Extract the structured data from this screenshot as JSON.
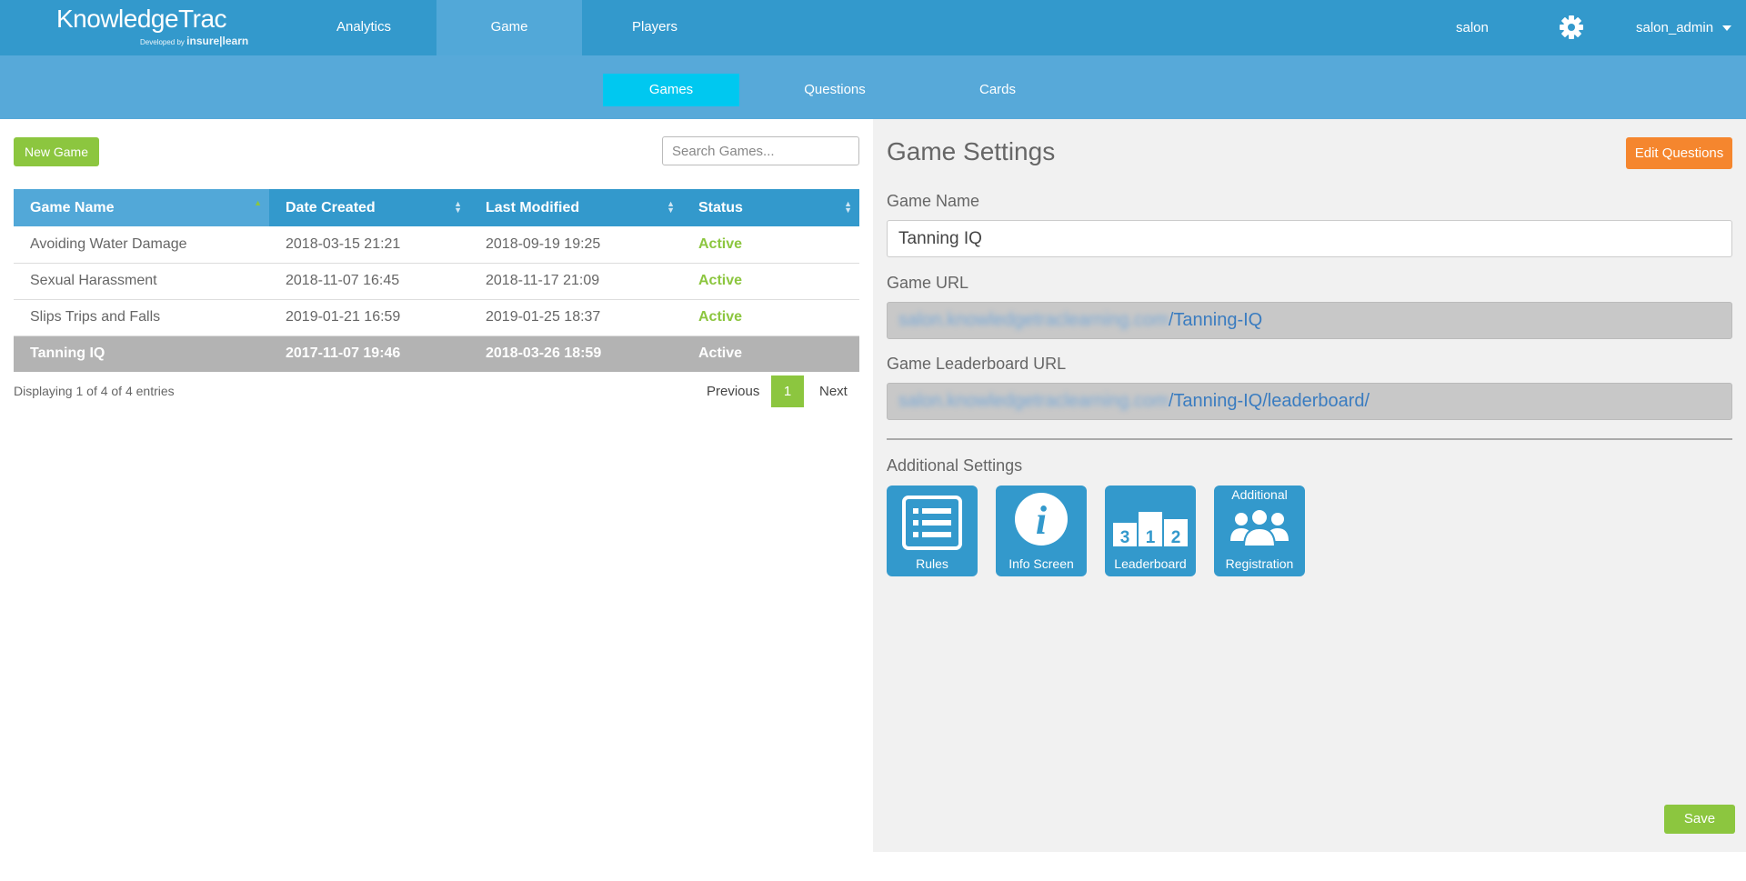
{
  "header": {
    "logo_text": "KnowledgeTrac",
    "logo_sub_prefix": "Developed by",
    "logo_sub_brand": "insure|learn",
    "nav": [
      {
        "label": "Analytics",
        "active": false
      },
      {
        "label": "Game",
        "active": true
      },
      {
        "label": "Players",
        "active": false
      }
    ],
    "site": "salon",
    "user": "salon_admin"
  },
  "subnav": [
    {
      "label": "Games",
      "active": true
    },
    {
      "label": "Questions",
      "active": false
    },
    {
      "label": "Cards",
      "active": false
    }
  ],
  "left": {
    "new_game_label": "New Game",
    "search_placeholder": "Search Games...",
    "columns": [
      "Game Name",
      "Date Created",
      "Last Modified",
      "Status"
    ],
    "rows": [
      {
        "name": "Avoiding Water Damage",
        "created": "2018-03-15 21:21",
        "modified": "2018-09-19 19:25",
        "status": "Active",
        "selected": false
      },
      {
        "name": "Sexual Harassment",
        "created": "2018-11-07 16:45",
        "modified": "2018-11-17 21:09",
        "status": "Active",
        "selected": false
      },
      {
        "name": "Slips Trips and Falls",
        "created": "2019-01-21 16:59",
        "modified": "2019-01-25 18:37",
        "status": "Active",
        "selected": false
      },
      {
        "name": "Tanning IQ",
        "created": "2017-11-07 19:46",
        "modified": "2018-03-26 18:59",
        "status": "Active",
        "selected": true
      }
    ],
    "info": "Displaying 1 of 4 of 4 entries",
    "pager": {
      "previous": "Previous",
      "page": "1",
      "next": "Next"
    }
  },
  "right": {
    "title": "Game Settings",
    "edit_questions_label": "Edit Questions",
    "game_name_label": "Game Name",
    "game_name_value": "Tanning IQ",
    "game_url_label": "Game URL",
    "game_url_host": "salon.knowledgetraclearning.com",
    "game_url_path": "/Tanning-IQ",
    "leaderboard_url_label": "Game Leaderboard URL",
    "leaderboard_url_host": "salon.knowledgetraclearning.com",
    "leaderboard_url_path": "/Tanning-IQ/leaderboard/",
    "additional_settings_label": "Additional Settings",
    "tiles": [
      {
        "label": "Rules",
        "icon": "list-icon"
      },
      {
        "label": "Info Screen",
        "icon": "info-icon"
      },
      {
        "label": "Leaderboard",
        "icon": "podium-icon",
        "podium": [
          "3",
          "1",
          "2"
        ]
      },
      {
        "top": "Additional",
        "label": "Registration",
        "icon": "users-icon"
      }
    ],
    "save_label": "Save"
  },
  "colors": {
    "primary_blue": "#3399cc",
    "subnav_blue": "#57a9d9",
    "active_cyan": "#00c8f0",
    "green": "#8cc63f",
    "orange": "#f5862e"
  }
}
